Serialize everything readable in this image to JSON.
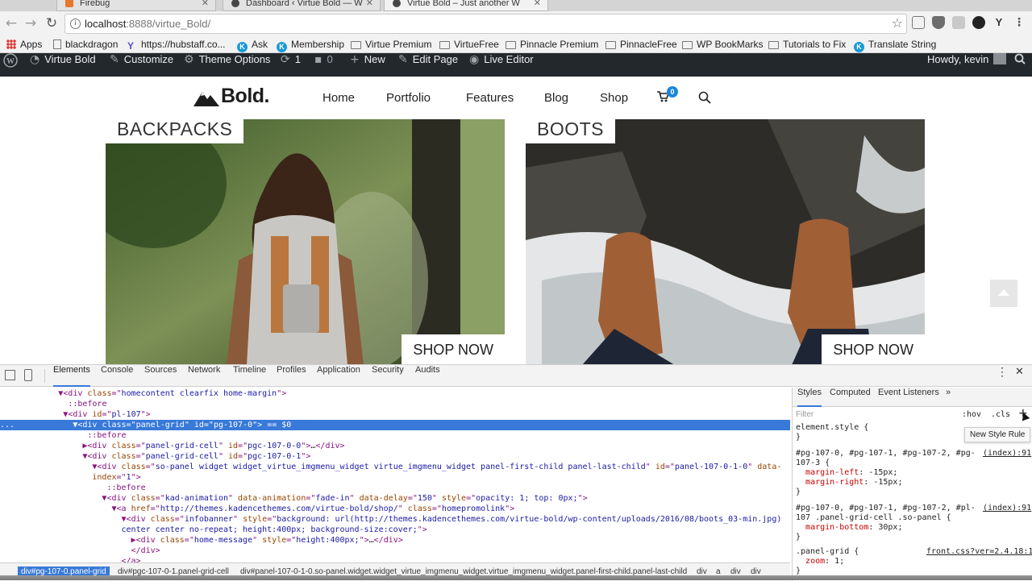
{
  "browser": {
    "tabs": [
      {
        "label": "Firebug",
        "active": false
      },
      {
        "label": "Dashboard ‹ Virtue Bold — W",
        "active": false
      },
      {
        "label": "Virtue Bold – Just another W",
        "active": true
      }
    ],
    "url_host": "localhost",
    "url_path": ":8888/virtue_Bold/",
    "bookmarks": [
      "Apps",
      "blackdragon",
      "https://hubstaff.co...",
      "Ask",
      "Membership",
      "Virtue Premium",
      "VirtueFree",
      "Pinnacle Premium",
      "PinnacleFree",
      "WP BookMarks",
      "Tutorials to Fix",
      "Translate String"
    ]
  },
  "adminbar": {
    "site_name": "Virtue Bold",
    "customize": "Customize",
    "theme_options": "Theme Options",
    "updates": "1",
    "comments": "0",
    "new": "New",
    "edit_page": "Edit Page",
    "live_editor": "Live Editor",
    "howdy": "Howdy, kevin"
  },
  "site": {
    "logo": "Bold.",
    "nav": [
      "Home",
      "Portfolio",
      "Features",
      "Blog",
      "Shop"
    ],
    "cart_count": "0",
    "promos": [
      {
        "label": "BACKPACKS",
        "button": "SHOP NOW"
      },
      {
        "label": "BOOTS",
        "button": "SHOP NOW"
      }
    ]
  },
  "devtools": {
    "tabs": [
      "Elements",
      "Console",
      "Sources",
      "Network",
      "Timeline",
      "Profiles",
      "Application",
      "Security",
      "Audits"
    ],
    "breadcrumbs": [
      "div#pg-107-0.panel-grid",
      "div#pgc-107-0-1.panel-grid-cell",
      "div#panel-107-0-1-0.so-panel.widget.widget_virtue_imgmenu_widget.virtue_imgmenu_widget.panel-first-child.panel-last-child",
      "div",
      "a",
      "div",
      "div"
    ],
    "styles_tabs": [
      "Styles",
      "Computed",
      "Event Listeners",
      "»"
    ],
    "filter_placeholder": "Filter",
    "hov": ":hov",
    "cls": ".cls",
    "tooltip": "New Style Rule"
  }
}
